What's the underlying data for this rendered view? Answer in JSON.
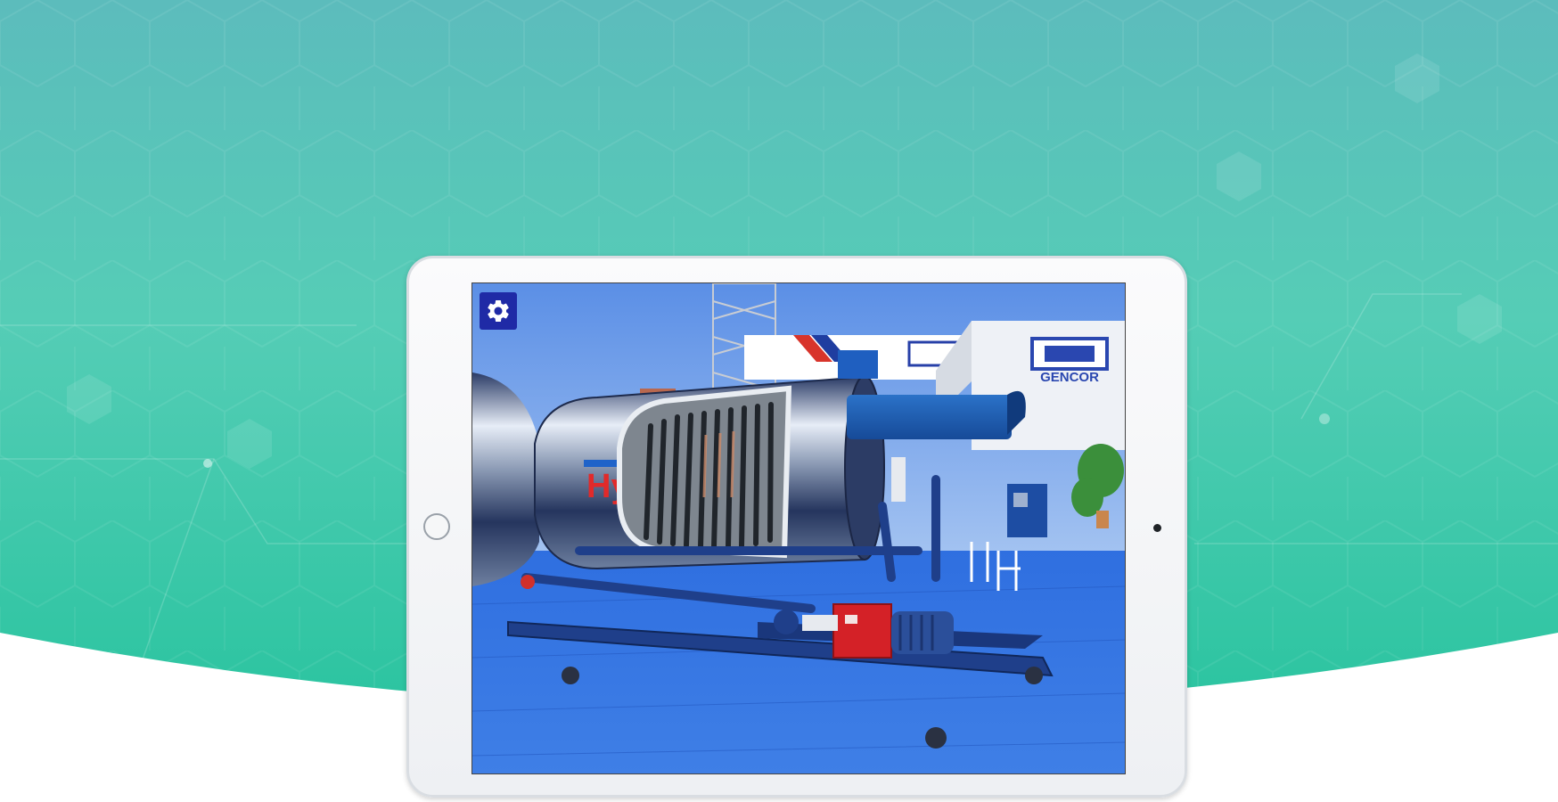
{
  "hero": {
    "background_color_top": "#57bdb9",
    "background_color_bottom": "#2ec3a0"
  },
  "device": {
    "type": "tablet",
    "frame_color": "#f3f4f6"
  },
  "screen": {
    "content": "photo",
    "settings_icon": "gear-icon",
    "settings_button_color": "#1f2aa6",
    "banner_logo_text": "GENCOR",
    "banner_partial_text": "Hy"
  }
}
